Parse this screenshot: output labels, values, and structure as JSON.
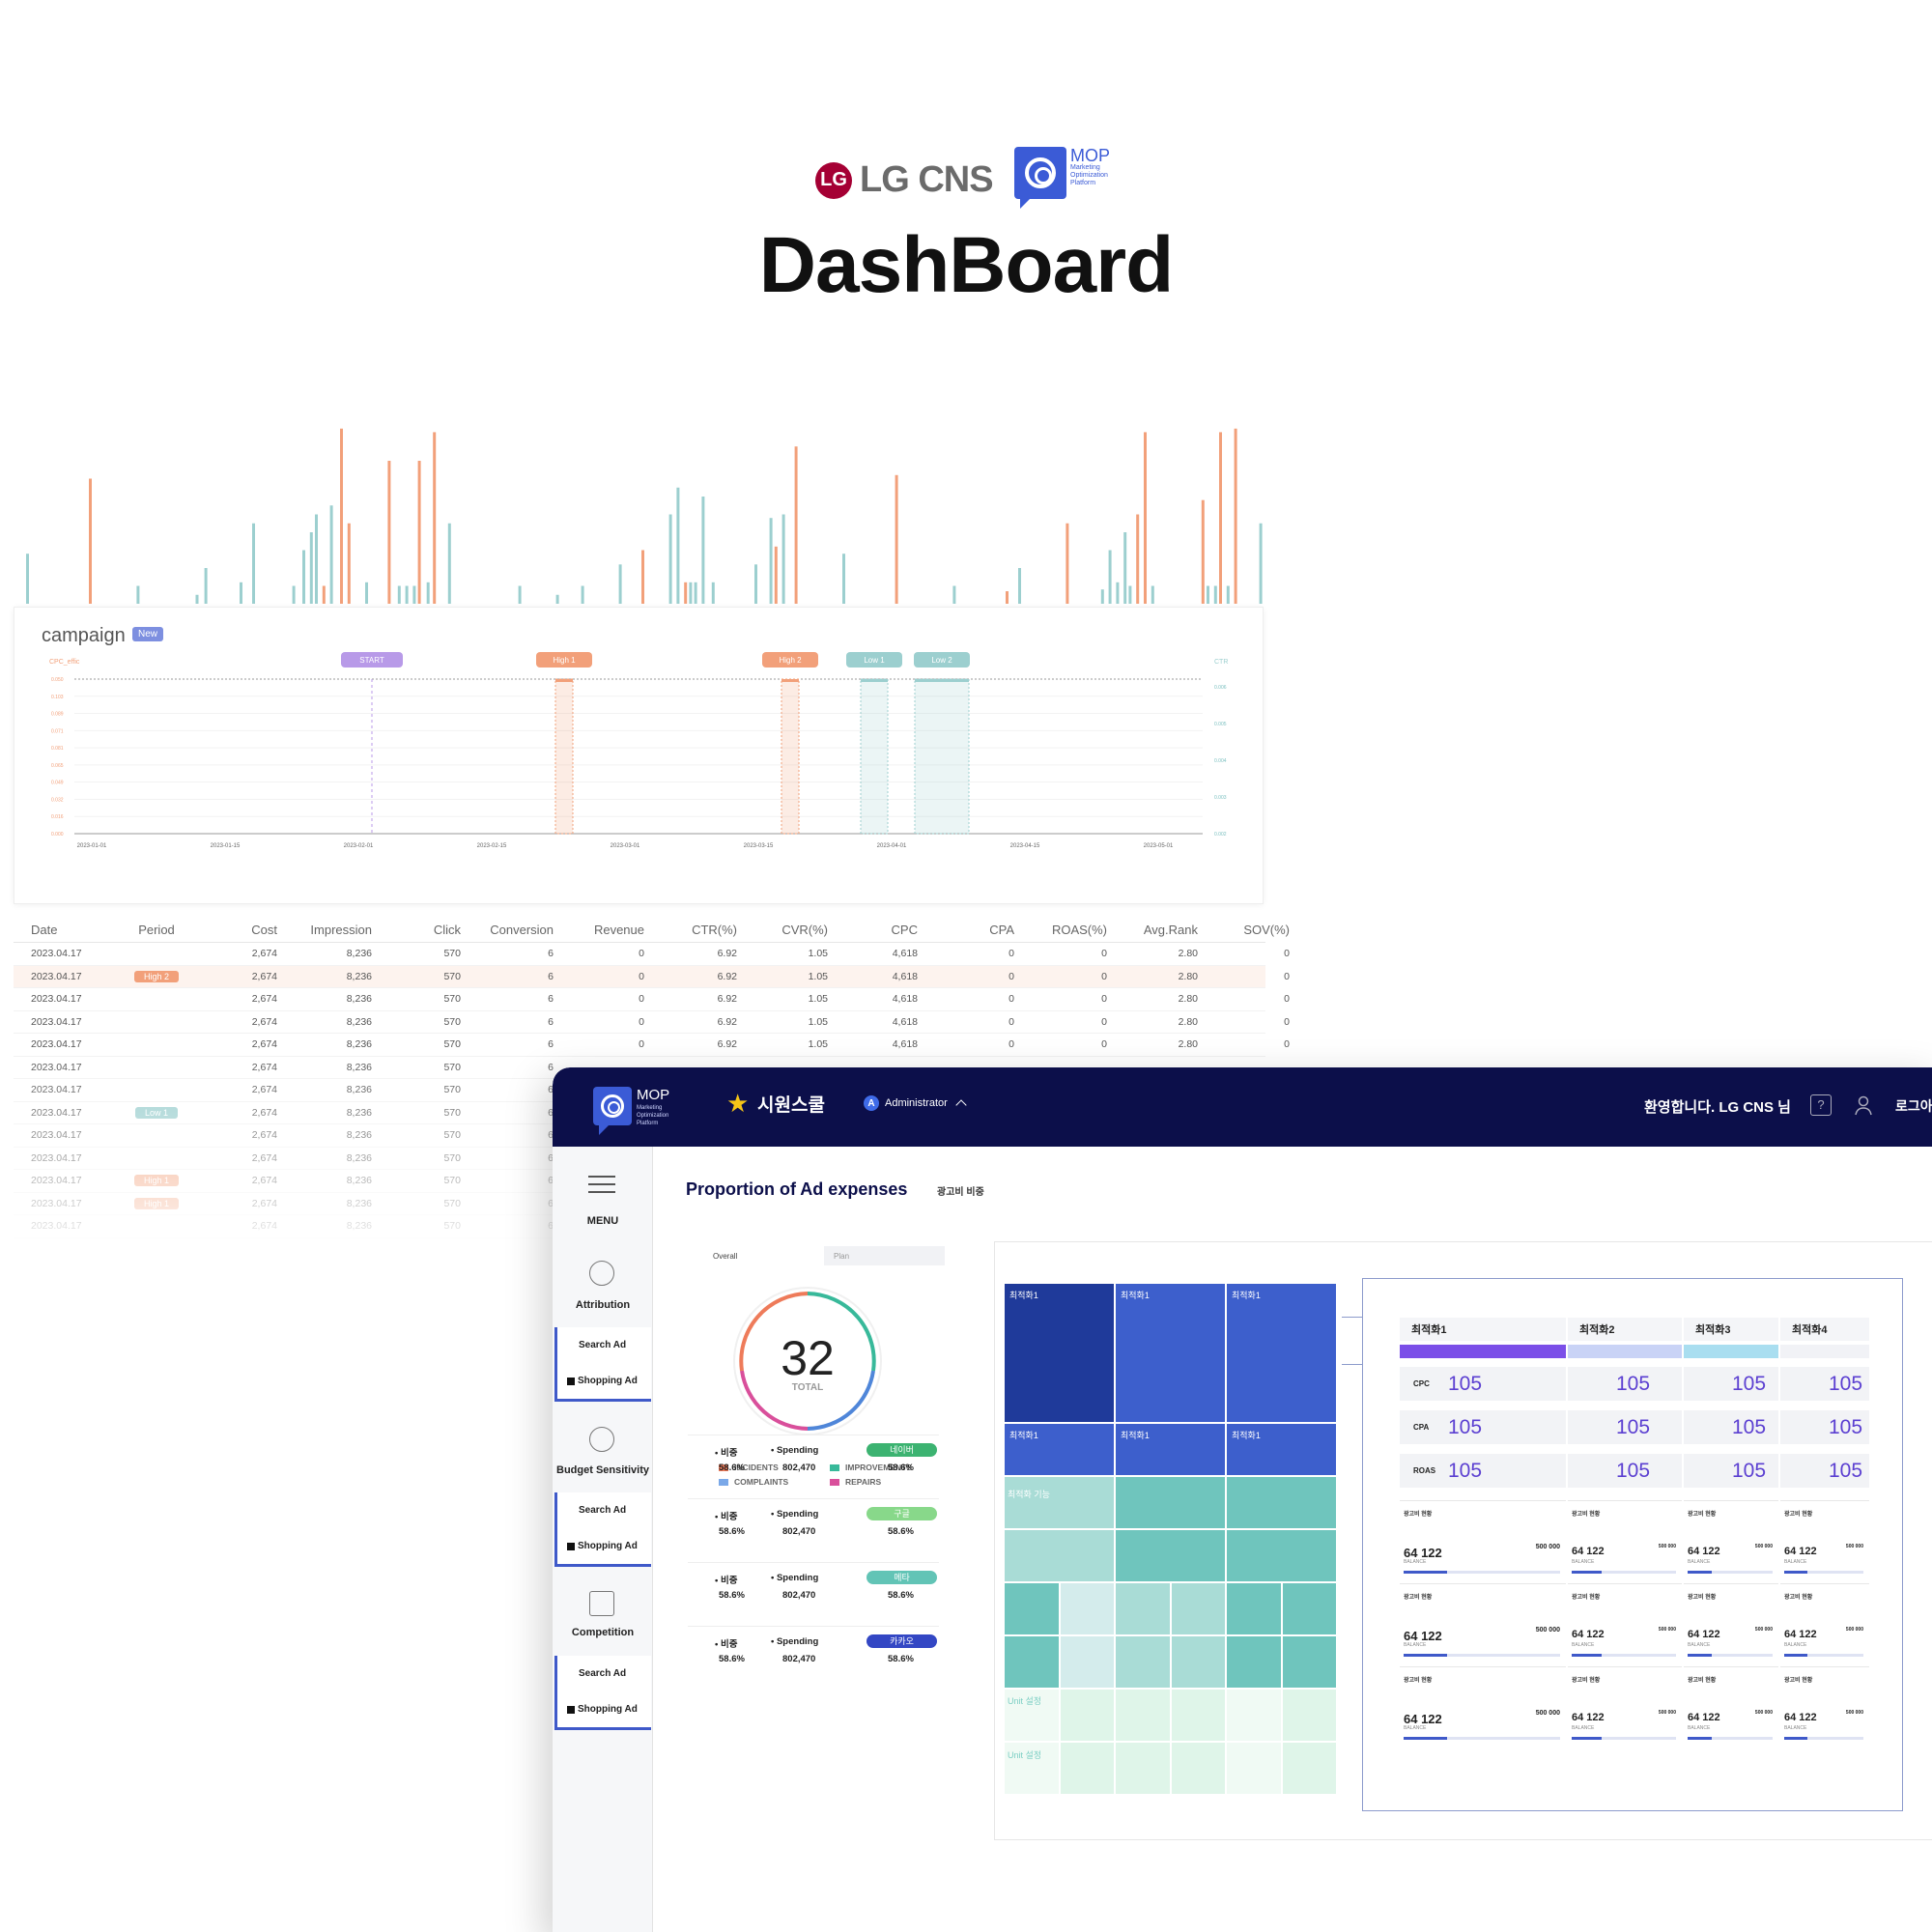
{
  "header": {
    "lg_logo_text": "LG CNS",
    "lg_logo_symbol": "LG",
    "mop_logo_word": "MOP",
    "mop_logo_sub": "Marketing Optimization Platform",
    "title": "DashBoard"
  },
  "campaign": {
    "title": "campaign",
    "badge": "New",
    "left_axis_label": "CPC_effic",
    "right_axis_label": "CTR",
    "markers": [
      "START",
      "High 1",
      "High 2",
      "Low 1",
      "Low 2"
    ]
  },
  "colors": {
    "orange": "#f2a07a",
    "teal": "#9ccfcf",
    "purple": "#b89ae8",
    "navy": "#0c0f4a",
    "accent_blue": "#3f59c9"
  },
  "chart_data": [
    {
      "type": "bar",
      "title": "",
      "series": [
        {
          "color": "orange",
          "values": [
            0,
            0,
            0,
            0,
            0,
            0,
            0,
            0,
            1,
            0,
            0,
            0,
            0,
            0,
            0,
            0,
            0,
            0,
            0,
            0,
            0,
            0,
            0,
            0,
            0,
            0,
            0,
            0,
            0,
            0,
            0,
            0,
            0,
            0,
            0,
            0,
            0,
            0,
            0,
            0,
            0,
            0,
            0.85,
            0,
            0,
            0,
            0,
            0,
            0,
            0,
            0,
            0,
            0,
            0,
            0,
            0,
            0,
            0,
            0,
            0,
            0,
            0,
            0,
            0,
            0,
            0,
            0,
            0,
            0,
            0,
            0,
            0,
            0,
            0,
            0,
            0,
            0,
            0,
            0,
            0,
            0,
            0,
            0,
            0,
            0,
            0,
            0,
            0,
            0,
            0,
            0,
            0,
            0,
            0,
            0,
            0,
            0
          ]
        },
        {
          "color": "teal",
          "values": [
            0.3,
            0,
            0,
            0,
            0.1,
            0,
            0,
            0,
            0,
            0,
            0.05,
            0.2,
            0.25,
            0.3,
            0.5
          ]
        }
      ]
    },
    {
      "type": "line",
      "title": "",
      "x_tick_labels": [
        "2023-01-01",
        "2023-01-15",
        "2023-02-01",
        "2023-02-15",
        "2023-03-01",
        "2023-03-15",
        "2023-04-01",
        "2023-04-15",
        "2023-05-01"
      ],
      "left_tick_labels": [
        "0.000",
        "0.016",
        "0.032",
        "0.049",
        "0.065",
        "0.081",
        "0.071",
        "0.089",
        "0.103",
        "0.050"
      ],
      "right_tick_labels": [
        "0.002",
        "0.003",
        "0.004",
        "0.005",
        "0.006"
      ],
      "markers": [
        "START",
        "High 1",
        "High 2",
        "Low 1",
        "Low 2"
      ]
    }
  ],
  "table": {
    "headers": [
      "Date",
      "Period",
      "Cost",
      "Impression",
      "Click",
      "Conversion",
      "Revenue",
      "CTR(%)",
      "CVR(%)",
      "CPC",
      "CPA",
      "ROAS(%)",
      "Avg.Rank",
      "SOV(%)"
    ],
    "rows": [
      {
        "date": "2023.04.17",
        "period": "",
        "cost": "2,674",
        "imp": "8,236",
        "click": "570",
        "conv": "6",
        "rev": "0",
        "ctr": "6.92",
        "cvr": "1.05",
        "cpc": "4,618",
        "cpa": "0",
        "roas": "0",
        "rank": "2.80",
        "sov": "0"
      },
      {
        "date": "2023.04.17",
        "period": "High 2",
        "cost": "2,674",
        "imp": "8,236",
        "click": "570",
        "conv": "6",
        "rev": "0",
        "ctr": "6.92",
        "cvr": "1.05",
        "cpc": "4,618",
        "cpa": "0",
        "roas": "0",
        "rank": "2.80",
        "sov": "0"
      },
      {
        "date": "2023.04.17",
        "period": "",
        "cost": "2,674",
        "imp": "8,236",
        "click": "570",
        "conv": "6",
        "rev": "0",
        "ctr": "6.92",
        "cvr": "1.05",
        "cpc": "4,618",
        "cpa": "0",
        "roas": "0",
        "rank": "2.80",
        "sov": "0"
      },
      {
        "date": "2023.04.17",
        "period": "",
        "cost": "2,674",
        "imp": "8,236",
        "click": "570",
        "conv": "6",
        "rev": "0",
        "ctr": "6.92",
        "cvr": "1.05",
        "cpc": "4,618",
        "cpa": "0",
        "roas": "0",
        "rank": "2.80",
        "sov": "0"
      },
      {
        "date": "2023.04.17",
        "period": "",
        "cost": "2,674",
        "imp": "8,236",
        "click": "570",
        "conv": "6",
        "rev": "0",
        "ctr": "6.92",
        "cvr": "1.05",
        "cpc": "4,618",
        "cpa": "0",
        "roas": "0",
        "rank": "2.80",
        "sov": "0"
      },
      {
        "date": "2023.04.17",
        "period": "",
        "cost": "2,674",
        "imp": "8,236",
        "click": "570",
        "conv": "6",
        "rev": "",
        "ctr": "",
        "cvr": "",
        "cpc": "",
        "cpa": "",
        "roas": "",
        "rank": "",
        "sov": ""
      },
      {
        "date": "2023.04.17",
        "period": "",
        "cost": "2,674",
        "imp": "8,236",
        "click": "570",
        "conv": "6",
        "rev": "",
        "ctr": "",
        "cvr": "",
        "cpc": "",
        "cpa": "",
        "roas": "",
        "rank": "",
        "sov": ""
      },
      {
        "date": "2023.04.17",
        "period": "Low 1",
        "cost": "2,674",
        "imp": "8,236",
        "click": "570",
        "conv": "6",
        "rev": "",
        "ctr": "",
        "cvr": "",
        "cpc": "",
        "cpa": "",
        "roas": "",
        "rank": "",
        "sov": ""
      },
      {
        "date": "2023.04.17",
        "period": "",
        "cost": "2,674",
        "imp": "8,236",
        "click": "570",
        "conv": "6",
        "rev": "",
        "ctr": "",
        "cvr": "",
        "cpc": "",
        "cpa": "",
        "roas": "",
        "rank": "",
        "sov": ""
      },
      {
        "date": "2023.04.17",
        "period": "",
        "cost": "2,674",
        "imp": "8,236",
        "click": "570",
        "conv": "6",
        "rev": "",
        "ctr": "",
        "cvr": "",
        "cpc": "",
        "cpa": "",
        "roas": "",
        "rank": "",
        "sov": ""
      },
      {
        "date": "2023.04.17",
        "period": "High 1",
        "cost": "2,674",
        "imp": "8,236",
        "click": "570",
        "conv": "6",
        "rev": "",
        "ctr": "",
        "cvr": "",
        "cpc": "",
        "cpa": "",
        "roas": "",
        "rank": "",
        "sov": ""
      },
      {
        "date": "2023.04.17",
        "period": "High 1",
        "cost": "2,674",
        "imp": "8,236",
        "click": "570",
        "conv": "6",
        "rev": "",
        "ctr": "",
        "cvr": "",
        "cpc": "",
        "cpa": "",
        "roas": "",
        "rank": "",
        "sov": ""
      },
      {
        "date": "2023.04.17",
        "period": "",
        "cost": "2,674",
        "imp": "8,236",
        "click": "570",
        "conv": "6",
        "rev": "",
        "ctr": "",
        "cvr": "",
        "cpc": "",
        "cpa": "",
        "roas": "",
        "rank": "",
        "sov": ""
      }
    ]
  },
  "app": {
    "mop_word": "MOP",
    "mop_sub": "Marketing Optimization Platform",
    "site_name": "시원스쿨",
    "role_initial": "A",
    "role": "Administrator",
    "welcome": "환영합니다. LG CNS 님",
    "help": "?",
    "login": "로그아웃"
  },
  "sidebar": {
    "menu": "MENU",
    "sections": [
      {
        "label": "Attribution",
        "subs": [
          "Search Ad",
          "Shopping Ad"
        ]
      },
      {
        "label": "Budget Sensitivity",
        "subs": [
          "Search Ad",
          "Shopping Ad"
        ]
      },
      {
        "label": "Competition",
        "subs": [
          "Search Ad",
          "Shopping Ad"
        ]
      }
    ]
  },
  "main": {
    "title": "Proportion of Ad expenses",
    "subtitle": "광고비 비중",
    "tabs": [
      "Overall",
      "Plan"
    ],
    "total": "32",
    "total_label": "TOTAL",
    "legend": [
      "INCIDENTS",
      "IMPROVEMENTS",
      "COMPLAINTS",
      "REPAIRS"
    ],
    "stats": [
      {
        "ratio_label": "비중",
        "ratio": "58.6%",
        "spend_label": "Spending",
        "spend": "802,470",
        "media": "네이버",
        "media_ratio": "58.6%",
        "color": "#3cb371"
      },
      {
        "ratio_label": "비중",
        "ratio": "58.6%",
        "spend_label": "Spending",
        "spend": "802,470",
        "media": "구글",
        "media_ratio": "58.6%",
        "color": "#88d88a"
      },
      {
        "ratio_label": "비중",
        "ratio": "58.6%",
        "spend_label": "Spending",
        "spend": "802,470",
        "media": "메타",
        "media_ratio": "58.6%",
        "color": "#62c4b6"
      },
      {
        "ratio_label": "비중",
        "ratio": "58.6%",
        "spend_label": "Spending",
        "spend": "802,470",
        "media": "카카오",
        "media_ratio": "58.6%",
        "color": "#3347c4"
      }
    ],
    "treemap_labels": [
      "최적화1",
      "최적화1",
      "최적화1",
      "최적화1",
      "최적화1",
      "최적화1"
    ],
    "treemap_side_labels": [
      "최적화 기능",
      "Unit 설정",
      "Unit 설정"
    ],
    "detail": {
      "columns": [
        "최적화1",
        "최적화2",
        "최적화3",
        "최적화4"
      ],
      "metric_labels": [
        "CPC",
        "CPA",
        "ROAS"
      ],
      "metric_value": "105",
      "balance_caption": "광고비 현황",
      "balance_value": "64 122",
      "balance_label": "BALANCE",
      "goal_value": "500 000",
      "goal_label": "GOAL"
    }
  }
}
